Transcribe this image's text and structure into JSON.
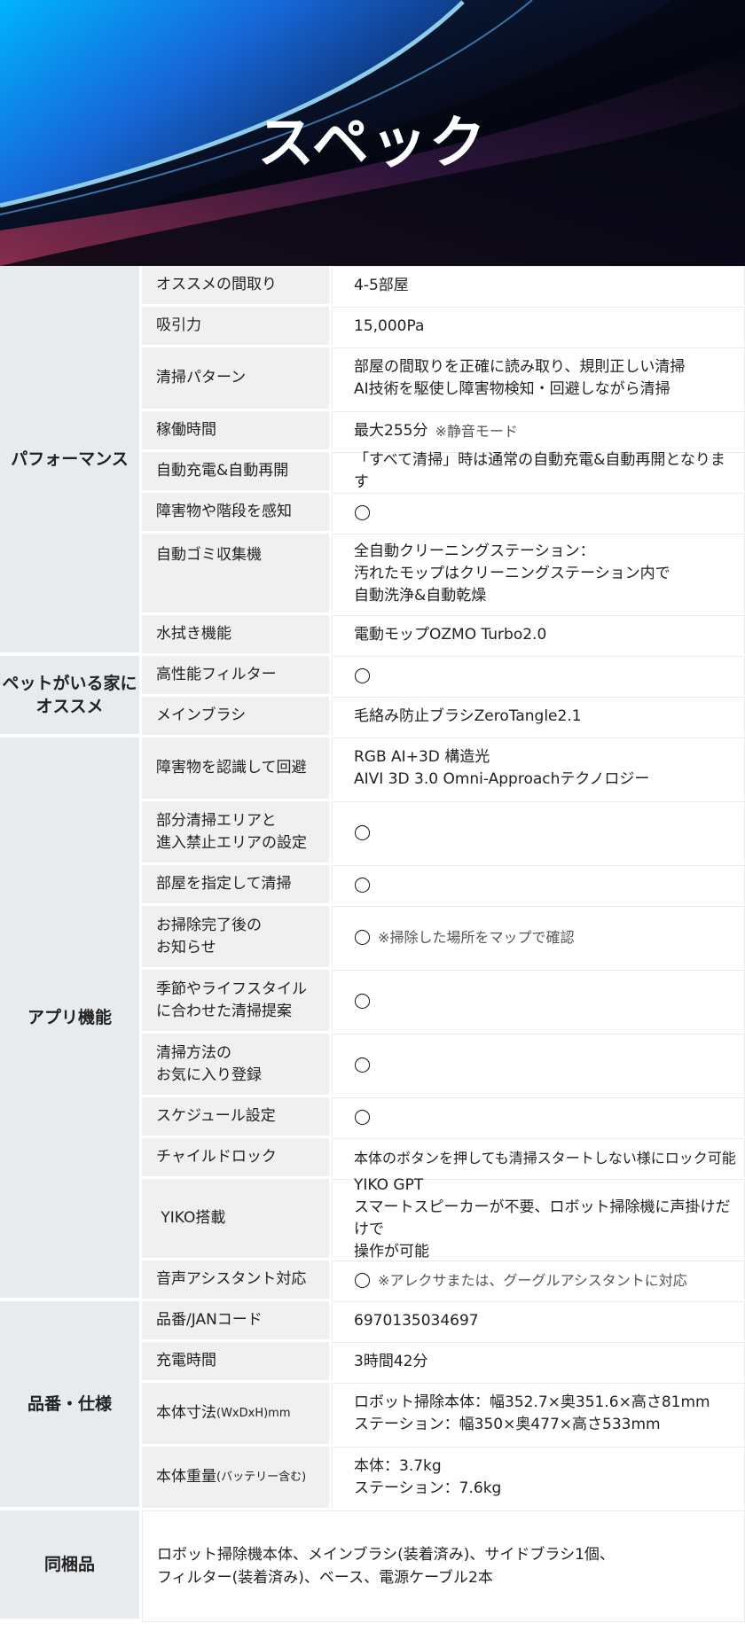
{
  "page_title": "スペック",
  "sections": [
    {
      "category": "パフォーマンス",
      "rows": [
        {
          "label": "オススメの間取り",
          "value": "4-5部屋"
        },
        {
          "label": "吸引力",
          "value": "15,000Pa"
        },
        {
          "label": "清掃パターン",
          "value": "部屋の間取りを正確に読み取り、規則正しい清掃\nAI技術を駆使し障害物検知・回避しながら清掃"
        },
        {
          "label": "稼働時間",
          "value": "最大255分",
          "note": "※静音モード"
        },
        {
          "label": "自動充電&自動再開",
          "value": "「すべて清掃」時は通常の自動充電&自動再開となります"
        },
        {
          "label": "障害物や階段を感知",
          "value": "◯"
        },
        {
          "label": "自動ゴミ収集機",
          "value": "全自動クリーニングステーション：\n汚れたモップはクリーニングステーション内で\n自動洗浄&自動乾燥"
        },
        {
          "label": "水拭き機能",
          "value": "電動モップOZMO Turbo2.0"
        }
      ]
    },
    {
      "category": "ペットがいる家に\nオススメ",
      "rows": [
        {
          "label": "高性能フィルター",
          "value": "◯"
        },
        {
          "label": "メインブラシ",
          "value": "毛絡み防止ブラシZeroTangle2.1"
        }
      ]
    },
    {
      "category": "アプリ機能",
      "rows": [
        {
          "label": "障害物を認識して回避",
          "value": "RGB AI+3D 構造光\nAIVI 3D 3.0 Omni-Approachテクノロジー"
        },
        {
          "label": "部分清掃エリアと\n進入禁止エリアの設定",
          "value": "◯"
        },
        {
          "label": "部屋を指定して清掃",
          "value": "◯"
        },
        {
          "label": "お掃除完了後の\nお知らせ",
          "value": "◯",
          "note": "※掃除した場所をマップで確認"
        },
        {
          "label": "季節やライフスタイル\nに合わせた清掃提案",
          "value": "◯"
        },
        {
          "label": "清掃方法の\nお気に入り登録",
          "value": "◯"
        },
        {
          "label": "スケジュール設定",
          "value": "◯"
        },
        {
          "label": "チャイルドロック",
          "value": "本体のボタンを押しても清掃スタートしない様にロック可能"
        },
        {
          "label": " YIKO搭載",
          "value": "YIKO GPT\nスマートスピーカーが不要、ロボット掃除機に声掛けだけで\n操作が可能"
        },
        {
          "label": "音声アシスタント対応",
          "value": "◯",
          "note": "※アレクサまたは、グーグルアシスタントに対応"
        }
      ]
    },
    {
      "category": "品番・仕様",
      "rows": [
        {
          "label": "品番/JANコード",
          "value": "6970135034697"
        },
        {
          "label": "充電時間",
          "value": "3時間42分"
        },
        {
          "label": "本体寸法",
          "label_small": "(WxDxH)mm",
          "value": "ロボット掃除本体：幅352.7×奥351.6×高さ81mm\nステーション：幅350×奥477×高さ533mm"
        },
        {
          "label": "本体重量",
          "label_small": "(バッテリー含む)",
          "value": "本体：3.7kg\nステーション：7.6kg"
        }
      ]
    }
  ],
  "bundle": {
    "category": "同梱品",
    "value": "ロボット掃除機本体、メインブラシ(装着済み)、サイドブラシ1個、\nフィルター(装着済み)、ベース、電源ケーブル2本"
  }
}
